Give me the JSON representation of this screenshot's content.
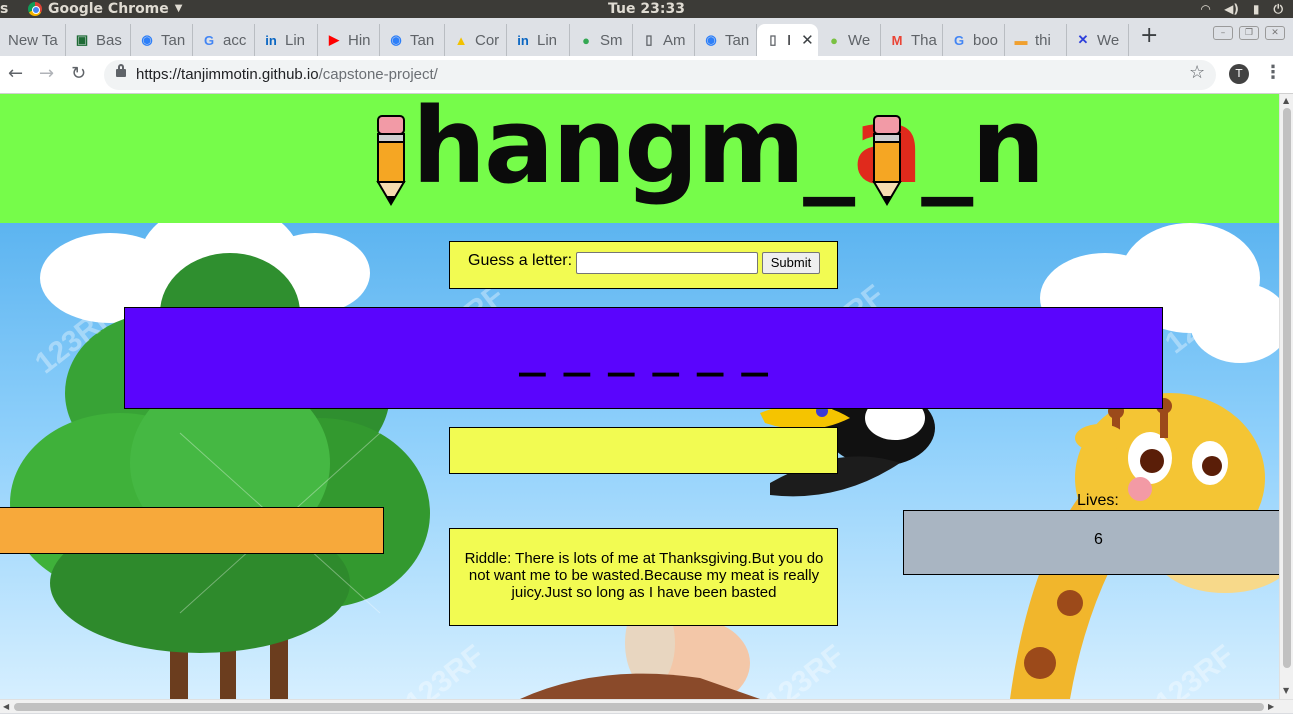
{
  "os": {
    "left_fragment": "s",
    "app_name": "Google Chrome",
    "clock": "Tue 23:33"
  },
  "tabs": [
    {
      "label": "New Ta",
      "icon": "blank-icon"
    },
    {
      "label": "Bas",
      "icon": "terminal-icon",
      "color": "#1e6b35"
    },
    {
      "label": "Tan",
      "icon": "chat-icon",
      "color": "#2d7ff9"
    },
    {
      "label": "acc",
      "icon": "google-icon",
      "color": "#4285f4"
    },
    {
      "label": "Lin",
      "icon": "linkedin-icon",
      "color": "#0a66c2"
    },
    {
      "label": "Hin",
      "icon": "youtube-icon",
      "color": "#ff0000"
    },
    {
      "label": "Tan",
      "icon": "chat-icon",
      "color": "#2d7ff9"
    },
    {
      "label": "Cor",
      "icon": "graduation-cap-icon",
      "color": "#f2c200"
    },
    {
      "label": "Lin",
      "icon": "linkedin-icon",
      "color": "#0a66c2"
    },
    {
      "label": "Sm",
      "icon": "map-pin-icon",
      "color": "#34a853"
    },
    {
      "label": "Am",
      "icon": "document-icon"
    },
    {
      "label": "Tan",
      "icon": "chat-icon",
      "color": "#2d7ff9"
    },
    {
      "label": "I",
      "icon": "document-icon",
      "active": true
    },
    {
      "label": "We",
      "icon": "leaf-icon",
      "color": "#7ac142"
    },
    {
      "label": "Tha",
      "icon": "gmail-icon",
      "color": "#ea4335"
    },
    {
      "label": "boo",
      "icon": "google-icon",
      "color": "#4285f4"
    },
    {
      "label": "thi",
      "icon": "image-icon",
      "color": "#f0a030"
    },
    {
      "label": "We",
      "icon": "cross-logo-icon",
      "color": "#2c3edb"
    }
  ],
  "toolbar": {
    "url_host": "https://tanjimmotin.github.io",
    "url_path": "/capstone-project/",
    "profile_initial": "T"
  },
  "game": {
    "logo": {
      "part1": "hangm",
      "underscore1": "_",
      "letter": "a",
      "underscore2": "_",
      "part2": "n"
    },
    "guess_label": "Guess a letter:",
    "guess_value": "",
    "submit_label": "Submit",
    "word_display": "— — — — — —",
    "message": "",
    "orange_text": "",
    "riddle": "Riddle: There is lots of me at Thanksgiving.But you do not want me to be wasted.Because my meat is really juicy.Just so long as I have been basted",
    "lives_label": "Lives:",
    "lives": "6"
  },
  "watermark": "123RF",
  "colors": {
    "header": "#76fc4a",
    "panel_yellow": "#f2fb52",
    "word_panel": "#5a05fd",
    "orange_panel": "#f7a93b",
    "lives_panel": "#a9b5c2"
  }
}
